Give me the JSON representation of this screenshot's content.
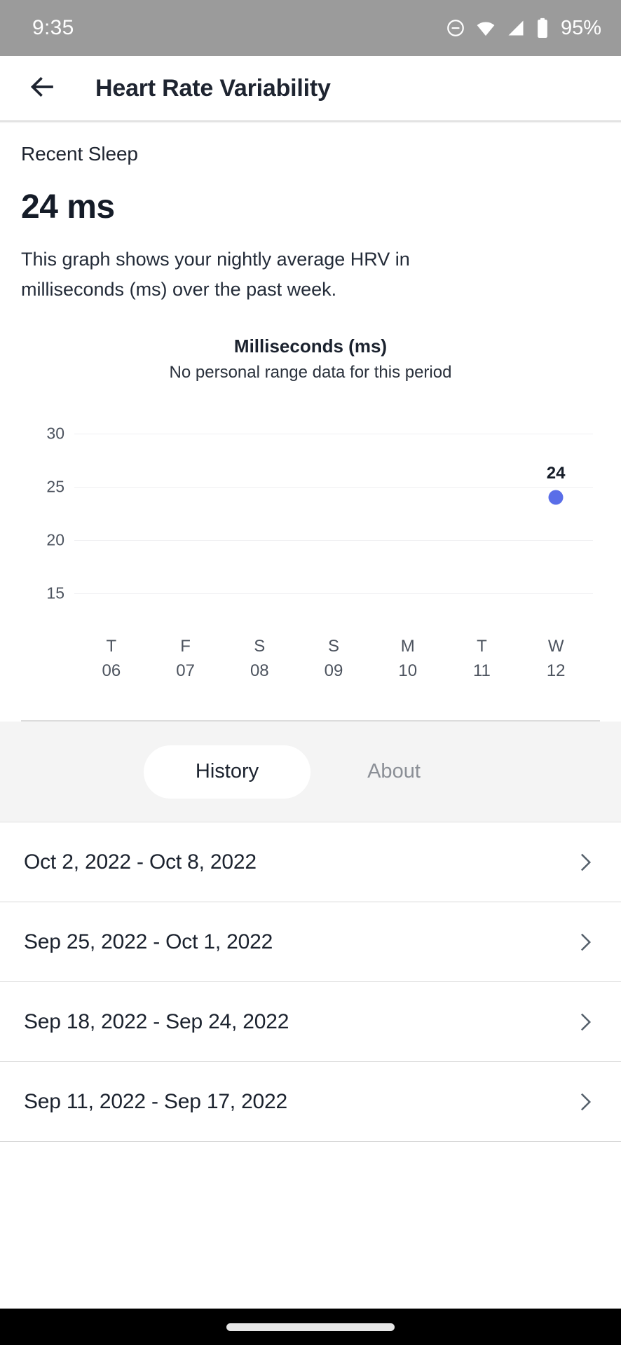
{
  "status_bar": {
    "time": "9:35",
    "battery_percent": "95%",
    "icons": [
      "do-not-disturb-icon",
      "wifi-icon",
      "cellular-signal-icon",
      "battery-icon"
    ]
  },
  "app_bar": {
    "back_icon": "back-arrow-icon",
    "title": "Heart Rate Variability"
  },
  "summary": {
    "label": "Recent Sleep",
    "value": "24 ms",
    "description_line1": "This graph shows your nightly average HRV in milliseconds",
    "description_line2": "(ms) over the past week."
  },
  "chart_data": {
    "type": "scatter",
    "title": "Milliseconds (ms)",
    "subtitle": "No personal range data for this period",
    "xlabel": "",
    "ylabel": "Milliseconds (ms)",
    "categories": [
      "T\n06",
      "F\n07",
      "S\n08",
      "S\n09",
      "M\n10",
      "T\n11",
      "W\n12"
    ],
    "x_ticks": [
      {
        "dow": "T",
        "day": "06"
      },
      {
        "dow": "F",
        "day": "07"
      },
      {
        "dow": "S",
        "day": "08"
      },
      {
        "dow": "S",
        "day": "09"
      },
      {
        "dow": "M",
        "day": "10"
      },
      {
        "dow": "T",
        "day": "11"
      },
      {
        "dow": "W",
        "day": "12"
      }
    ],
    "y_ticks": [
      "30",
      "25",
      "20",
      "15"
    ],
    "ylim": [
      13,
      32
    ],
    "grid": true,
    "legend": "none",
    "point_color": "#5a6ee8",
    "series": [
      {
        "name": "Nightly average HRV",
        "values": [
          null,
          null,
          null,
          null,
          null,
          null,
          24
        ],
        "labels": [
          null,
          null,
          null,
          null,
          null,
          null,
          "24"
        ]
      }
    ]
  },
  "tabs": [
    {
      "label": "History",
      "active": true
    },
    {
      "label": "About",
      "active": false
    }
  ],
  "history": {
    "rows": [
      {
        "range": "Oct 2, 2022 - Oct 8, 2022"
      },
      {
        "range": "Sep 25, 2022 - Oct 1, 2022"
      },
      {
        "range": "Sep 18, 2022 - Sep 24, 2022"
      },
      {
        "range": "Sep 11, 2022 - Sep 17, 2022"
      }
    ],
    "chevron_icon": "chevron-right-icon"
  },
  "nav_bar": {
    "home_indicator": "home-indicator"
  },
  "colors": {
    "accent": "#5a6ee8",
    "status_bar_bg": "#9b9b9b",
    "text_primary": "#1b222e",
    "text_muted": "#8b8f96",
    "tab_bar_bg": "#f4f4f4"
  }
}
